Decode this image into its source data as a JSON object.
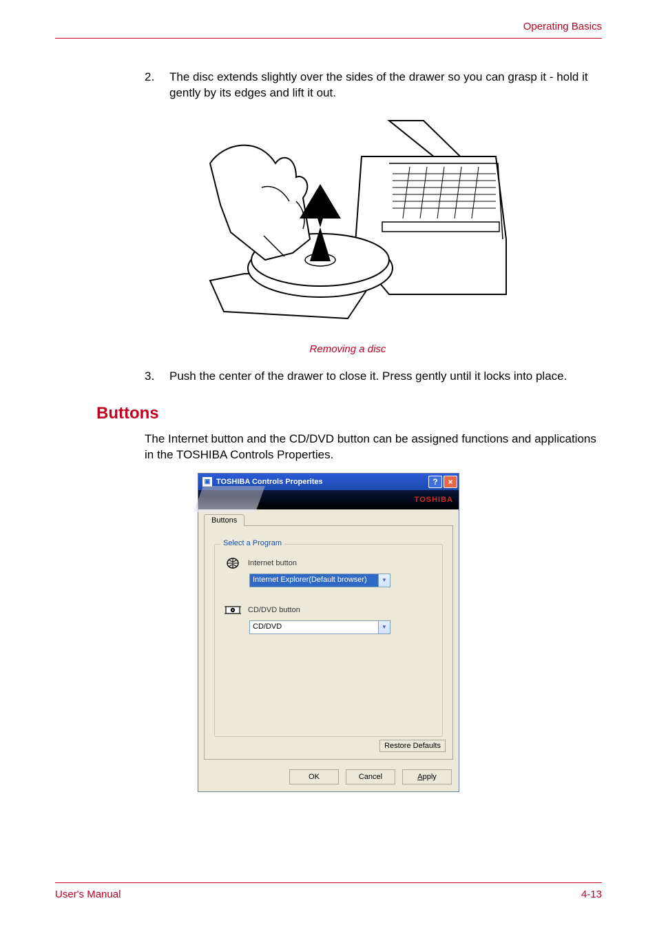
{
  "header": {
    "section": "Operating Basics"
  },
  "steps": {
    "two_num": "2.",
    "two_text": "The disc extends slightly over the sides of the drawer so you can grasp it - hold it gently by its edges and lift it out.",
    "three_num": "3.",
    "three_text": "Push the center of the drawer to close it. Press gently until it locks into place."
  },
  "figure": {
    "caption": "Removing a disc"
  },
  "section": {
    "heading": "Buttons",
    "intro": "The Internet button and the CD/DVD button can be assigned functions and applications in the TOSHIBA Controls Properties."
  },
  "dialog": {
    "title": "TOSHIBA Controls Properites",
    "brand": "TOSHIBA",
    "tab": "Buttons",
    "group_legend": "Select a Program",
    "internet_label": "Internet button",
    "internet_value": "Internet Explorer(Default browser)",
    "cddvd_label": "CD/DVD button",
    "cddvd_value": "CD/DVD",
    "restore": "Restore Defaults",
    "ok": "OK",
    "cancel": "Cancel",
    "apply": "Apply"
  },
  "footer": {
    "left": "User's Manual",
    "right": "4-13"
  }
}
